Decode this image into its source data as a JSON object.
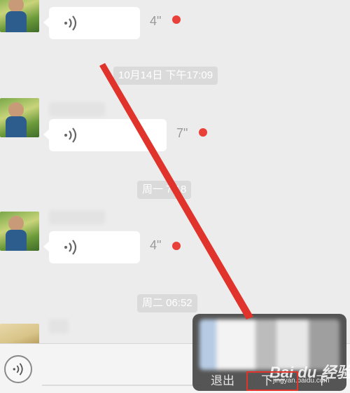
{
  "messages": [
    {
      "duration": "4\"",
      "unread": true
    },
    {
      "duration": "7\"",
      "unread": true
    },
    {
      "duration": "4\"",
      "unread": true
    }
  ],
  "timestamps": [
    "10月14日 下午17:09",
    "周一 7:18",
    "周二 06:52"
  ],
  "overlay": {
    "exit_label": "退出",
    "next_label": "下一",
    "right_label": "下"
  },
  "watermark": {
    "brand": "Bai du 经验",
    "url": "jingyan.baidu.com"
  },
  "colors": {
    "unread_dot": "#e8413a",
    "annotation_arrow": "#e0332b",
    "background": "#ececec"
  },
  "icons": {
    "voice": "voice-wave-icon",
    "mic": "voice-input-icon"
  }
}
